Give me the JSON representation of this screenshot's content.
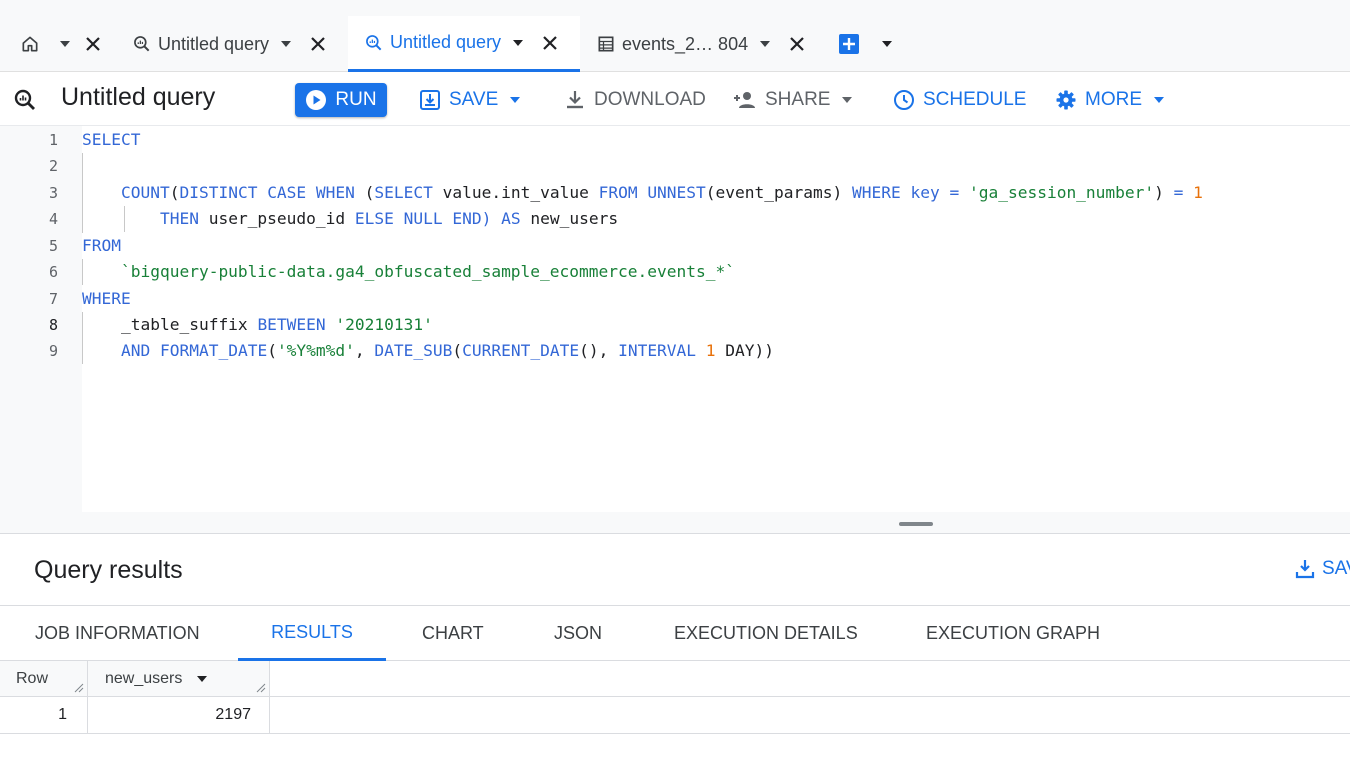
{
  "tabs": [
    {
      "label": "",
      "icon": "home-icon"
    },
    {
      "label": "Untitled query",
      "icon": "query-icon"
    },
    {
      "label": "Untitled query",
      "icon": "query-icon",
      "active": true
    },
    {
      "label": "events_2… 804",
      "icon": "table-icon"
    }
  ],
  "toolbar": {
    "title": "Untitled query",
    "run_label": "RUN",
    "save_label": "SAVE",
    "download_label": "DOWNLOAD",
    "share_label": "SHARE",
    "schedule_label": "SCHEDULE",
    "more_label": "MORE"
  },
  "editor": {
    "line_numbers": [
      "1",
      "2",
      "3",
      "4",
      "5",
      "6",
      "7",
      "8",
      "9"
    ],
    "code": {
      "l1_select": "SELECT",
      "l3_count": "COUNT",
      "l3_p1": "(",
      "l3_distinct": "DISTINCT",
      "l3_case": "CASE",
      "l3_when": "WHEN",
      "l3_p2": "(",
      "l3_select": "SELECT",
      "l3_value": "value.int_value",
      "l3_from": "FROM",
      "l3_unnest": "UNNEST",
      "l3_params": "(event_params)",
      "l3_where": "WHERE",
      "l3_key": "key",
      "l3_eq": "=",
      "l3_str": "'ga_session_number'",
      "l3_close": ")",
      "l3_eq2": "=",
      "l3_one": "1",
      "l4_then": "THEN",
      "l4_uid": "user_pseudo_id",
      "l4_else": "ELSE",
      "l4_null": "NULL",
      "l4_end": "END)",
      "l4_as": "AS",
      "l4_alias": "new_users",
      "l5_from": "FROM",
      "l6_table": "`bigquery-public-data.ga4_obfuscated_sample_ecommerce.events_*`",
      "l7_where": "WHERE",
      "l8_suffix": "_table_suffix",
      "l8_between": "BETWEEN",
      "l8_str": "'20210131'",
      "l9_and": "AND",
      "l9_format": "FORMAT_DATE",
      "l9_p1": "(",
      "l9_fmt": "'%Y%m%d'",
      "l9_comma": ",",
      "l9_datesub": "DATE_SUB",
      "l9_p2": "(",
      "l9_current": "CURRENT_DATE",
      "l9_p3": "(),",
      "l9_interval": "INTERVAL",
      "l9_one": "1",
      "l9_day": "DAY))"
    }
  },
  "results": {
    "title": "Query results",
    "save_label": "SAV",
    "tabs": [
      "JOB INFORMATION",
      "RESULTS",
      "CHART",
      "JSON",
      "EXECUTION DETAILS",
      "EXECUTION GRAPH"
    ],
    "active_tab": "RESULTS",
    "columns": [
      "Row",
      "new_users"
    ],
    "rows": [
      [
        "1",
        "2197"
      ]
    ]
  },
  "colors": {
    "accent": "#1a73e8",
    "keyword": "#3367d6",
    "string": "#188038",
    "number": "#e8710a"
  }
}
